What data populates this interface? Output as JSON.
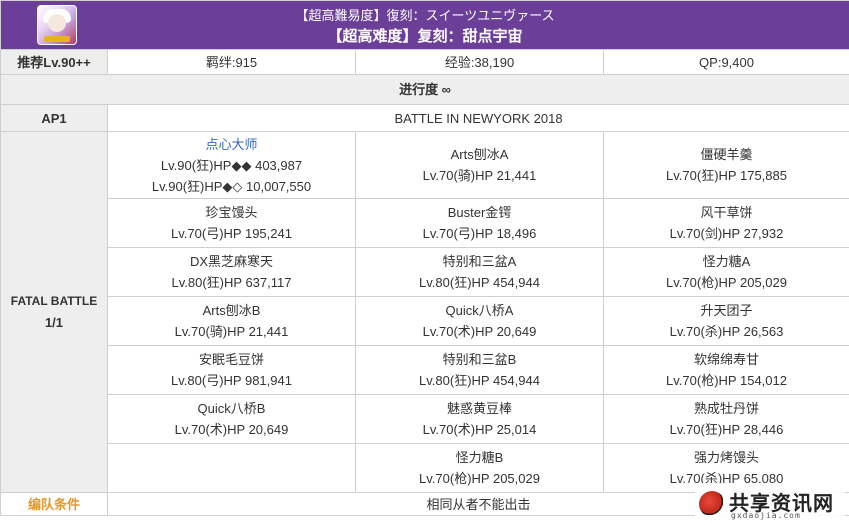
{
  "header": {
    "title_jp": "【超高難易度】復刻：スイーツユニヴァース",
    "title_cn": "【超高难度】复刻：甜点宇宙"
  },
  "rewards": {
    "recommend": "推荐Lv.90++",
    "bond": "羁绊:915",
    "exp": "经验:38,190",
    "qp": "QP:9,400"
  },
  "progress": "进行度 ∞",
  "ap": {
    "label": "AP1",
    "battle_title": "BATTLE IN NEWYORK 2018"
  },
  "fatal": {
    "label": "FATAL BATTLE",
    "count": "1/1"
  },
  "enemies": [
    [
      {
        "name": "点心大师",
        "stats": [
          "Lv.90(狂)HP◆◆ 403,987",
          "Lv.90(狂)HP◆◇ 10,007,550"
        ]
      },
      {
        "name": "Arts刨冰A",
        "stats": [
          "Lv.70(骑)HP 21,441"
        ]
      },
      {
        "name": "僵硬羊羹",
        "stats": [
          "Lv.70(狂)HP 175,885"
        ]
      }
    ],
    [
      {
        "name": "珍宝馒头",
        "stats": [
          "Lv.70(弓)HP 195,241"
        ]
      },
      {
        "name": "Buster金锷",
        "stats": [
          "Lv.70(弓)HP 18,496"
        ]
      },
      {
        "name": "风干草饼",
        "stats": [
          "Lv.70(剑)HP 27,932"
        ]
      }
    ],
    [
      {
        "name": "DX黑芝麻寒天",
        "stats": [
          "Lv.80(狂)HP 637,117"
        ]
      },
      {
        "name": "特别和三盆A",
        "stats": [
          "Lv.80(狂)HP 454,944"
        ]
      },
      {
        "name": "怪力糖A",
        "stats": [
          "Lv.70(枪)HP 205,029"
        ]
      }
    ],
    [
      {
        "name": "Arts刨冰B",
        "stats": [
          "Lv.70(骑)HP 21,441"
        ]
      },
      {
        "name": "Quick八桥A",
        "stats": [
          "Lv.70(术)HP 20,649"
        ]
      },
      {
        "name": "升天团子",
        "stats": [
          "Lv.70(杀)HP 26,563"
        ]
      }
    ],
    [
      {
        "name": "安眠毛豆饼",
        "stats": [
          "Lv.80(弓)HP 981,941"
        ]
      },
      {
        "name": "特别和三盆B",
        "stats": [
          "Lv.80(狂)HP 454,944"
        ]
      },
      {
        "name": "软绵绵寿甘",
        "stats": [
          "Lv.70(枪)HP 154,012"
        ]
      }
    ],
    [
      {
        "name": "Quick八桥B",
        "stats": [
          "Lv.70(术)HP 20,649"
        ]
      },
      {
        "name": "魅惑黄豆棒",
        "stats": [
          "Lv.70(术)HP 25,014"
        ]
      },
      {
        "name": "熟成牡丹饼",
        "stats": [
          "Lv.70(狂)HP 28,446"
        ]
      }
    ],
    [
      {
        "name": "",
        "stats": []
      },
      {
        "name": "怪力糖B",
        "stats": [
          "Lv.70(枪)HP 205,029"
        ]
      },
      {
        "name": "强力烤馒头",
        "stats": [
          "Lv.70(杀)HP 65,080"
        ]
      }
    ]
  ],
  "formation": {
    "label": "编队条件",
    "value": "相同从者不能出击"
  },
  "watermark": {
    "text": "共享资讯网",
    "sub": "gxdaojia.com"
  },
  "colors": {
    "header_bg": "#6b3f98",
    "label_bg": "#eeeeee",
    "link": "#3366cc",
    "formation_label": "#e2992f",
    "border": "#cfcfcf"
  }
}
